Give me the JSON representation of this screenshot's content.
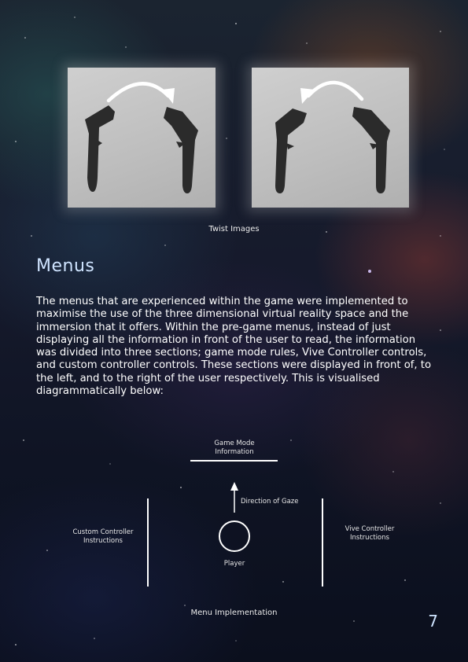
{
  "figure": {
    "caption": "Twist Images",
    "images": [
      {
        "name": "twist-left-to-right",
        "arrow_direction": "right"
      },
      {
        "name": "twist-right-to-left",
        "arrow_direction": "left"
      }
    ]
  },
  "section": {
    "title": "Menus",
    "body": "The menus that are experienced within the game were implemented to maximise the use of the three dimensional virtual reality space and the immersion that it offers. Within the pre-game menus, instead of just displaying all the information in front of the user to read, the information was divided into three sections; game mode rules, Vive Controller controls, and custom controller controls. These sections were displayed in front of, to the left, and to the right of the user respectively. This is visualised diagrammatically below:"
  },
  "diagram": {
    "front_label": "Game Mode\nInformation",
    "left_label": "Custom Controller\nInstructions",
    "right_label": "Vive Controller\nInstructions",
    "gaze_label": "Direction of Gaze",
    "player_label": "Player",
    "caption": "Menu Implementation"
  },
  "page_number": "7",
  "colors": {
    "heading": "#cfe4ff",
    "text": "#ffffff",
    "photo_bg": "#c4c4c4",
    "controller": "#2b2b2b"
  }
}
